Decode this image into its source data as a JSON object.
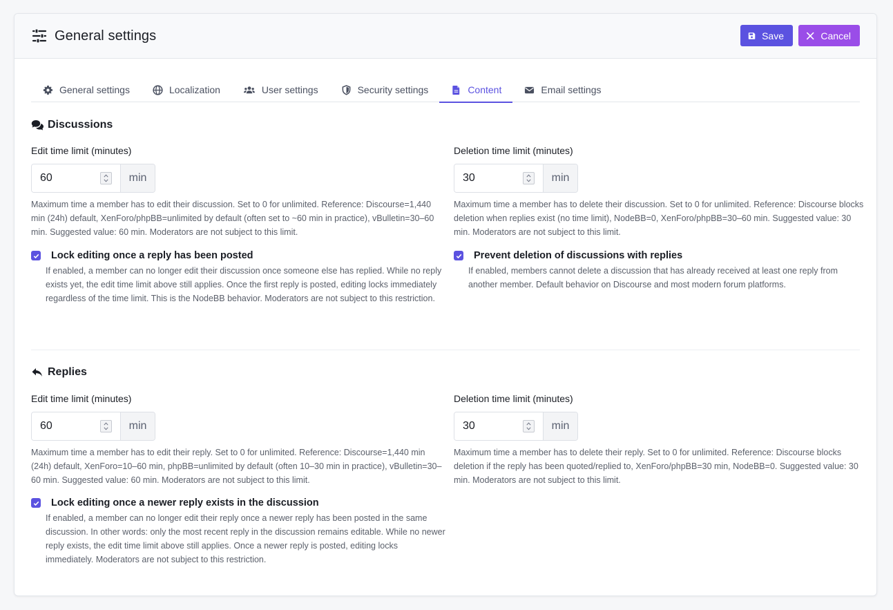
{
  "header": {
    "title": "General settings",
    "save_label": "Save",
    "cancel_label": "Cancel"
  },
  "tabs": [
    {
      "label": "General settings",
      "icon": "gear-icon"
    },
    {
      "label": "Localization",
      "icon": "globe-icon"
    },
    {
      "label": "User settings",
      "icon": "users-icon"
    },
    {
      "label": "Security settings",
      "icon": "shield-icon"
    },
    {
      "label": "Content",
      "icon": "document-icon",
      "active": true
    },
    {
      "label": "Email settings",
      "icon": "envelope-icon"
    }
  ],
  "discussions": {
    "title": "Discussions",
    "edit": {
      "label": "Edit time limit (minutes)",
      "value": "60",
      "unit": "min",
      "help": "Maximum time a member has to edit their discussion. Set to 0 for unlimited. Reference: Discourse=1,440 min (24h) default, XenForo/phpBB=unlimited by default (often set to ~60 min in practice), vBulletin=30–60 min. Suggested value: 60 min. Moderators are not subject to this limit."
    },
    "delete": {
      "label": "Deletion time limit (minutes)",
      "value": "30",
      "unit": "min",
      "help": "Maximum time a member has to delete their discussion. Set to 0 for unlimited. Reference: Discourse blocks deletion when replies exist (no time limit), NodeBB=0, XenForo/phpBB=30–60 min. Suggested value: 30 min. Moderators are not subject to this limit."
    },
    "lock_edit": {
      "label": "Lock editing once a reply has been posted",
      "checked": true,
      "help": "If enabled, a member can no longer edit their discussion once someone else has replied. While no reply exists yet, the edit time limit above still applies. Once the first reply is posted, editing locks immediately regardless of the time limit. This is the NodeBB behavior. Moderators are not subject to this restriction."
    },
    "prevent_delete": {
      "label": "Prevent deletion of discussions with replies",
      "checked": true,
      "help": "If enabled, members cannot delete a discussion that has already received at least one reply from another member. Default behavior on Discourse and most modern forum platforms."
    }
  },
  "replies": {
    "title": "Replies",
    "edit": {
      "label": "Edit time limit (minutes)",
      "value": "60",
      "unit": "min",
      "help": "Maximum time a member has to edit their reply. Set to 0 for unlimited. Reference: Discourse=1,440 min (24h) default, XenForo=10–60 min, phpBB=unlimited by default (often 10–30 min in practice), vBulletin=30–60 min. Suggested value: 60 min. Moderators are not subject to this limit."
    },
    "delete": {
      "label": "Deletion time limit (minutes)",
      "value": "30",
      "unit": "min",
      "help": "Maximum time a member has to delete their reply. Set to 0 for unlimited. Reference: Discourse blocks deletion if the reply has been quoted/replied to, XenForo/phpBB=30 min, NodeBB=0. Suggested value: 30 min. Moderators are not subject to this limit."
    },
    "lock_edit": {
      "label": "Lock editing once a newer reply exists in the discussion",
      "checked": true,
      "help": "If enabled, a member can no longer edit their reply once a newer reply has been posted in the same discussion. In other words: only the most recent reply in the discussion remains editable. While no newer reply exists, the edit time limit above still applies. Once a newer reply is posted, editing locks immediately. Moderators are not subject to this restriction."
    }
  },
  "colors": {
    "accent": "#5b52e0",
    "cancel": "#9a4de8"
  }
}
